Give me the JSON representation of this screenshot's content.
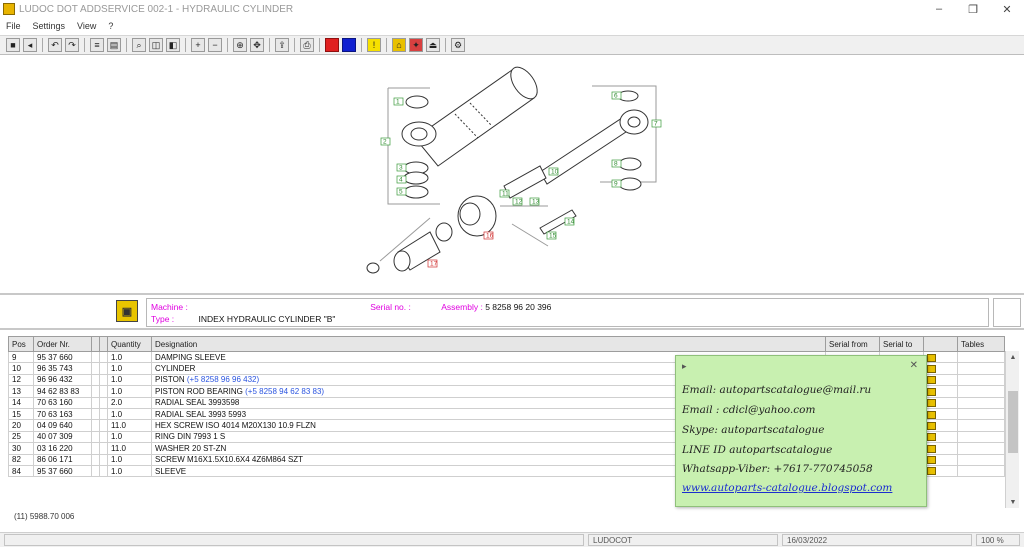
{
  "window": {
    "title": "LUDOC DOT ADDSERVICE 002-1 - HYDRAULIC CYLINDER",
    "controls": [
      "–",
      "❐",
      "✕"
    ]
  },
  "menu": {
    "items": [
      "File",
      "Settings",
      "View",
      "?"
    ]
  },
  "drawing": {
    "callouts": [
      "1",
      "2",
      "3",
      "4",
      "5",
      "6",
      "7",
      "8",
      "9",
      "10",
      "11",
      "12",
      "13",
      "14",
      "15",
      "16",
      "17"
    ]
  },
  "info": {
    "machine_label": "Machine :",
    "type_label": "Type :",
    "type_value": "INDEX HYDRAULIC CYLINDER \"B\"",
    "serial_label": "Serial no. :",
    "assembly_label": "Assembly :",
    "assembly_value": "5 8258 96 20 396"
  },
  "table": {
    "headers": [
      "Pos",
      "Order Nr.",
      "",
      "",
      "Quantity",
      "Designation",
      "Serial from",
      "Serial to",
      "",
      "Tables"
    ],
    "rows": [
      {
        "pos": "9",
        "order": "95 37 660",
        "qty": "1.0",
        "desc": "DAMPING SLEEVE",
        "link": ""
      },
      {
        "pos": "10",
        "order": "96 35 743",
        "qty": "1.0",
        "desc": "CYLINDER",
        "link": ""
      },
      {
        "pos": "12",
        "order": "96 96 432",
        "qty": "1.0",
        "desc": "PISTON",
        "link": "(+5 8258 96 96 432)"
      },
      {
        "pos": "13",
        "order": "94 62 83 83",
        "qty": "1.0",
        "desc": "PISTON ROD BEARING",
        "link": "(+5 8258 94 62 83 83)"
      },
      {
        "pos": "14",
        "order": "70 63 160",
        "qty": "2.0",
        "desc": "RADIAL SEAL 3993598",
        "link": ""
      },
      {
        "pos": "15",
        "order": "70 63 163",
        "qty": "1.0",
        "desc": "RADIAL SEAL 3993 5993",
        "link": ""
      },
      {
        "pos": "20",
        "order": "04 09 640",
        "qty": "11.0",
        "desc": "HEX SCREW ISO 4014 M20X130 10.9 FLZN",
        "link": ""
      },
      {
        "pos": "25",
        "order": "40 07 309",
        "qty": "1.0",
        "desc": "RING DIN 7993 1 S",
        "link": ""
      },
      {
        "pos": "30",
        "order": "03 16 220",
        "qty": "11.0",
        "desc": "WASHER 20 ST-ZN",
        "link": ""
      },
      {
        "pos": "82",
        "order": "86 06 171",
        "qty": "1.0",
        "desc": "SCREW M16X1.5X10.6X4 4Z6M864 SZT",
        "link": ""
      },
      {
        "pos": "84",
        "order": "95 37 660",
        "qty": "1.0",
        "desc": "SLEEVE",
        "link": ""
      }
    ],
    "footer": "(11) 5988.70 006"
  },
  "popup": {
    "email1": "Email: autopartscatalogue@mail.ru",
    "email2": "Email : cdicl@yahoo.com",
    "skype": "Skype: autopartscatalogue",
    "line": "LINE ID autopartscatalogue",
    "whatsapp": "Whatsapp-Viber: +7617-770745058",
    "link": "www.autoparts-catalogue.blogspot.com"
  },
  "status": {
    "center": "LUDOCOT",
    "right": "16/03/2022",
    "zoom": "100 %"
  },
  "colors": {
    "order_green": "#2aa020",
    "label_magenta": "#e000e0",
    "link_blue": "#2a54e0",
    "popup_green": "#c8f0b0"
  }
}
